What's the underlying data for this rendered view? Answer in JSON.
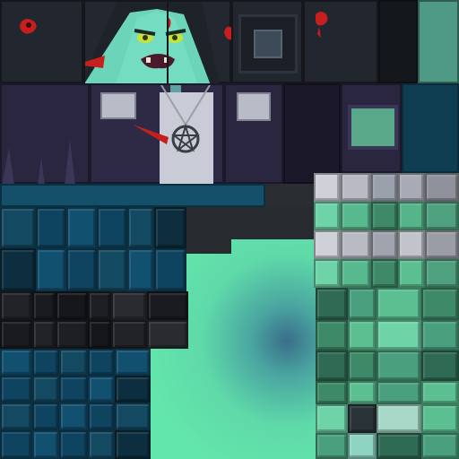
{
  "texture": {
    "kind": "skin-texture-atlas",
    "palette": {
      "head_dark": "#23272f",
      "body_purple": "#2a2640",
      "cyan_dark": "#0f3e52",
      "cyan_mid": "#14506a",
      "blackish": "#1c1d22",
      "mint": "#63e6ab",
      "grey_shirt": "#c9cbd6",
      "blood_red": "#c81e1e",
      "face_green": "#6fd3b8",
      "eye_yellow": "#c6e23a"
    },
    "icons": [
      "blood-splatter-icon",
      "hooded-creature-face-icon",
      "pentagram-pendant-icon",
      "square-eye-icon"
    ]
  }
}
